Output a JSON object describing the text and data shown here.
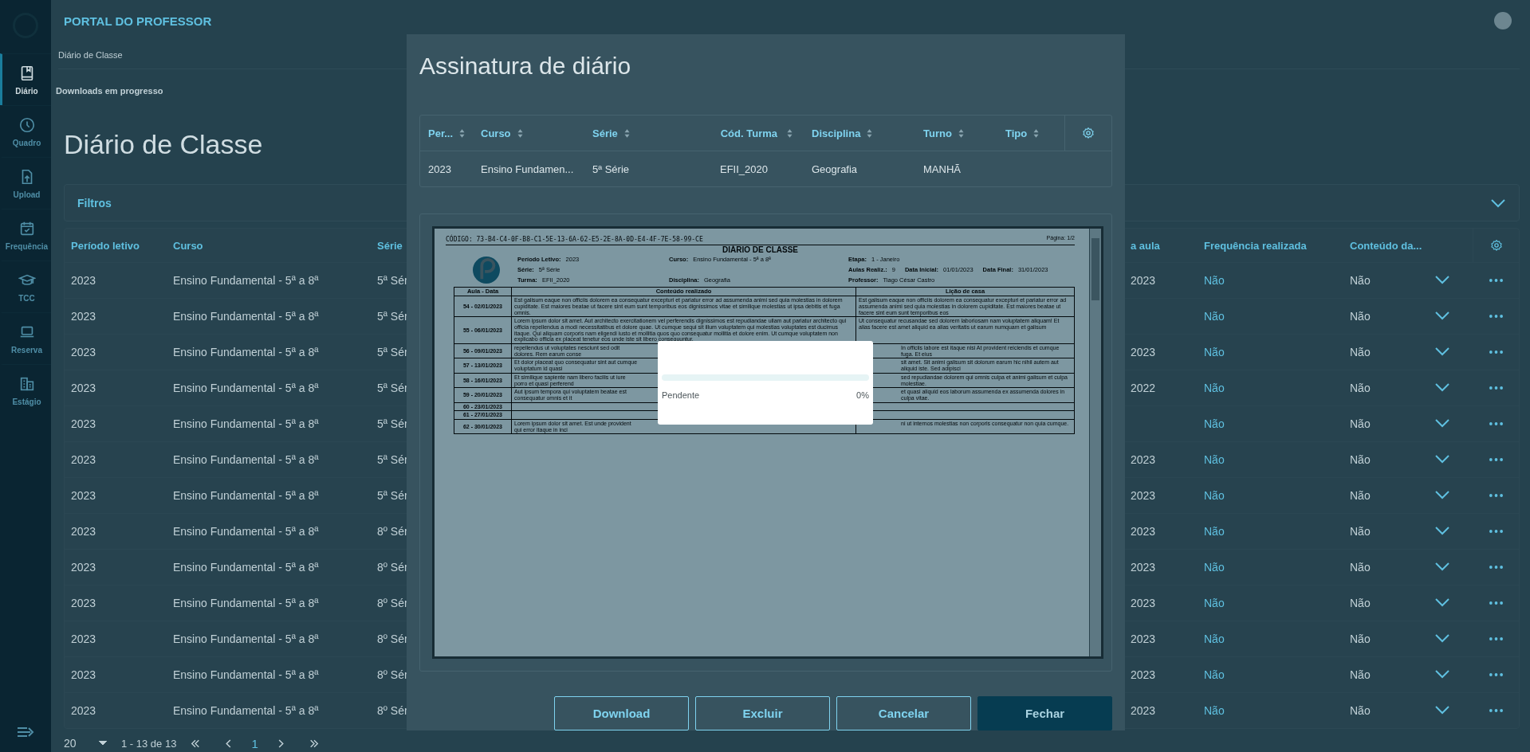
{
  "app": {
    "title": "PORTAL DO PROFESSOR"
  },
  "sidebar": {
    "items": [
      {
        "label": "Diário",
        "selected": true
      },
      {
        "label": "Quadro",
        "selected": false
      },
      {
        "label": "Upload",
        "selected": false
      },
      {
        "label": "Frequência",
        "selected": false
      },
      {
        "label": "TCC",
        "selected": false
      },
      {
        "label": "Reserva",
        "selected": false
      },
      {
        "label": "Estágio",
        "selected": false
      }
    ]
  },
  "breadcrumb": "Diário de Classe",
  "downloads_link": "Downloads em progresso",
  "page_title": "Diário de Classe",
  "filters": {
    "title": "Filtros"
  },
  "table": {
    "columns": [
      "Período letivo",
      "Curso",
      "Série",
      "a aula",
      "Frequência realizada",
      "Conteúdo da..."
    ],
    "rows": [
      {
        "periodo": "2023",
        "curso": "Ensino Fundamental - 5ª a 8ª",
        "serie": "5ª Sér",
        "column_4": "2023",
        "frequencia": "Não",
        "conteudo": "Não"
      },
      {
        "periodo": "2023",
        "curso": "Ensino Fundamental - 5ª a 8ª",
        "serie": "5ª Sér",
        "frequencia": "Não",
        "conteudo": "Não"
      },
      {
        "periodo": "2023",
        "curso": "Ensino Fundamental - 5ª a 8ª",
        "serie": "5ª Sér",
        "column_4": "2023",
        "frequencia": "Não",
        "conteudo": "Não"
      },
      {
        "periodo": "2023",
        "curso": "Ensino Fundamental - 5ª a 8ª",
        "serie": "5ª Sér",
        "column_4": "2022",
        "frequencia": "Não",
        "conteudo": "Não"
      },
      {
        "periodo": "2023",
        "curso": "Ensino Fundamental - 5ª a 8ª",
        "serie": "5ª Sér",
        "frequencia": "Não",
        "conteudo": "Não"
      },
      {
        "periodo": "2023",
        "curso": "Ensino Fundamental - 5ª a 8ª",
        "serie": "5ª Sér",
        "column_4": "2023",
        "frequencia": "Não",
        "conteudo": "Não"
      },
      {
        "periodo": "2023",
        "curso": "Ensino Fundamental - 5ª a 8ª",
        "serie": "5ª Sér",
        "column_4": "2023",
        "frequencia": "Não",
        "conteudo": "Não"
      },
      {
        "periodo": "2023",
        "curso": "Ensino Fundamental - 5ª a 8ª",
        "serie": "8º Sér",
        "column_4": "2023",
        "frequencia": "Não",
        "conteudo": "Não"
      },
      {
        "periodo": "2023",
        "curso": "Ensino Fundamental - 5ª a 8ª",
        "serie": "8º Sér",
        "column_4": "2023",
        "frequencia": "Não",
        "conteudo": "Não"
      },
      {
        "periodo": "2023",
        "curso": "Ensino Fundamental - 5ª a 8ª",
        "serie": "8º Sér",
        "column_4": "2023",
        "frequencia": "Não",
        "conteudo": "Não"
      },
      {
        "periodo": "2023",
        "curso": "Ensino Fundamental - 5ª a 8ª",
        "serie": "8º Sér",
        "column_4": "2023",
        "frequencia": "Não",
        "conteudo": "Não"
      },
      {
        "periodo": "2023",
        "curso": "Ensino Fundamental - 5ª a 8ª",
        "serie": "8º Sér",
        "column_4": "2023",
        "frequencia": "Não",
        "conteudo": "Não"
      },
      {
        "periodo": "2023",
        "curso": "Ensino Fundamental - 5ª a 8ª",
        "serie": "8º Sér",
        "column_4": "2023",
        "frequencia": "Não",
        "conteudo": "Não"
      }
    ]
  },
  "pagination": {
    "page_size": "20",
    "range": "1 - 13 de 13",
    "pages": [
      {
        "label": "1",
        "selected": true
      }
    ]
  },
  "modal": {
    "title": "Assinatura de diário",
    "table": {
      "columns": [
        "Per...",
        "Curso",
        "Série",
        "Cód. Turma",
        "Disciplina",
        "Turno",
        "Tipo"
      ],
      "rows": [
        {
          "cells": [
            "2023",
            "Ensino Fundamen...",
            "5ª Série",
            "EFII_2020",
            "Geografia",
            "MANHÃ"
          ]
        }
      ]
    },
    "document": {
      "code": "CÓDIGO: 73-B4-C4-0F-B8-C1-5E-13-6A-62-E5-2E-8A-0D-E4-4F-7E-58-99-CE",
      "page": "Página: 1/2",
      "title": "DIÁRIO DE CLASSE",
      "field_rows": [
        {
          "left": {
            "label": "Período Letivo:",
            "value": "2023"
          },
          "middle": {
            "label": "Curso:",
            "value": "Ensino Fundamental - 5ª a 8ª"
          },
          "right": [
            {
              "label": "Etapa:",
              "value": "1 - Janeiro"
            }
          ]
        },
        {
          "left": {
            "label": "Série:",
            "value": "5ª Série"
          },
          "right": [
            {
              "label": "Aulas Realiz.:",
              "value": "9"
            },
            {
              "label": "Data Inicial:",
              "value": "01/01/2023"
            },
            {
              "label": "Data Final:",
              "value": "31/01/2023"
            }
          ]
        },
        {
          "left": {
            "label": "Turma:",
            "value": "EFII_2020"
          },
          "middle": {
            "label": "Disciplina:",
            "value": "Geografia"
          },
          "right": [
            {
              "label": "Professor:",
              "value": "Tiago César Castro"
            }
          ]
        }
      ],
      "table": {
        "columns": [
          "Aula - Data",
          "Conteúdo realizado",
          "Lição de casa"
        ],
        "rows": [
          {
            "aula": "54 - 02/01/2023",
            "conteudo": "Est galisum eaque non officiis dolorem ea consequatur excepturi et pariatur error ad assumenda animi sed quia molestias in dolorem cupiditate. Est maiores beatae ut facere sint eum sunt temporibus eos dignissimos vitae et similique molestias ut ipsa debitis et fuga omnis.",
            "licao": "Est galisum eaque non officiis dolorem ea consequatur excepturi et pariatur error ad assumenda animi sed quia molestias in dolorem cupiditate. Est maiores beatae ut facere sint eum sunt temporibus eos"
          },
          {
            "aula": "55 - 06/01/2023",
            "conteudo": "Lorem ipsum dolor sit amet. Aut architecto exercitationem vel perferendis dignissimos est repudiandae ullam aut pariatur architecto qui officia repellendus a modi necessitatibus et dolore quae. Ut cumque sequi sit illum voluptatem qui molestias voluptates est ducimus itaque. Qui aliquam corporis nam eligendi iusto et mollitia quos quo consequatur mollitia et dolore enim. Ut cumque voluptatem non explicabo officia ex placeat tenetur eos unde iste sit libero consequuntur.",
            "licao": "Ut consequatur recusandae sed dolorem laboriosam nam voluptatem aliquam! Et alias facere est amet aliquid ea alias veritatis ut earum numquam et galisum"
          },
          {
            "aula": "56 - 09/01/2023",
            "conteudo": "repellendus ut voluptates nesciunt sed odit dolores. Rem earum conse",
            "licao": "In officiis labore est itaque nisi At provident reiciendis et cumque fuga. Et eius"
          },
          {
            "aula": "57 - 13/01/2023",
            "conteudo": "Et dolor placeat quo consequatur sint aut cumque voluptatum id quasi",
            "licao": "sit amet. Sit animi galisum sit dolorum earum hic nihil autem aut aliquid iste. Sed adipisci"
          },
          {
            "aula": "58 - 16/01/2023",
            "conteudo": "Et similique sapiente nam libero facilis ut iure porro et quasi perferend",
            "licao": "sed repudiandae dolorem qui omnis culpa et animi galisum et culpa molestiae."
          },
          {
            "aula": "59 - 20/01/2023",
            "conteudo": "Aut ipsum tempora qui voluptatem beatae est consequatur omnis et it",
            "licao": "et quasi aliquid eos laborum assumenda ex assumenda dolores in culpa vitae."
          },
          {
            "aula": "60 - 23/01/2023"
          },
          {
            "aula": "61 - 27/01/2023"
          },
          {
            "aula": "62 - 30/01/2023",
            "conteudo": "Lorem ipsum dolor sit amet. Est unde provident qui error itaque in inci",
            "licao": "ni ut internos molestias non corporis consequatur non quia cumque."
          }
        ]
      }
    },
    "progress": {
      "status": "Pendente",
      "percent": "0%",
      "level": 0
    },
    "buttons": [
      {
        "label": "Download",
        "kind": "outline"
      },
      {
        "label": "Excluir",
        "kind": "outline"
      },
      {
        "label": "Cancelar",
        "kind": "outline"
      },
      {
        "label": "Fechar",
        "kind": "primary"
      }
    ]
  }
}
